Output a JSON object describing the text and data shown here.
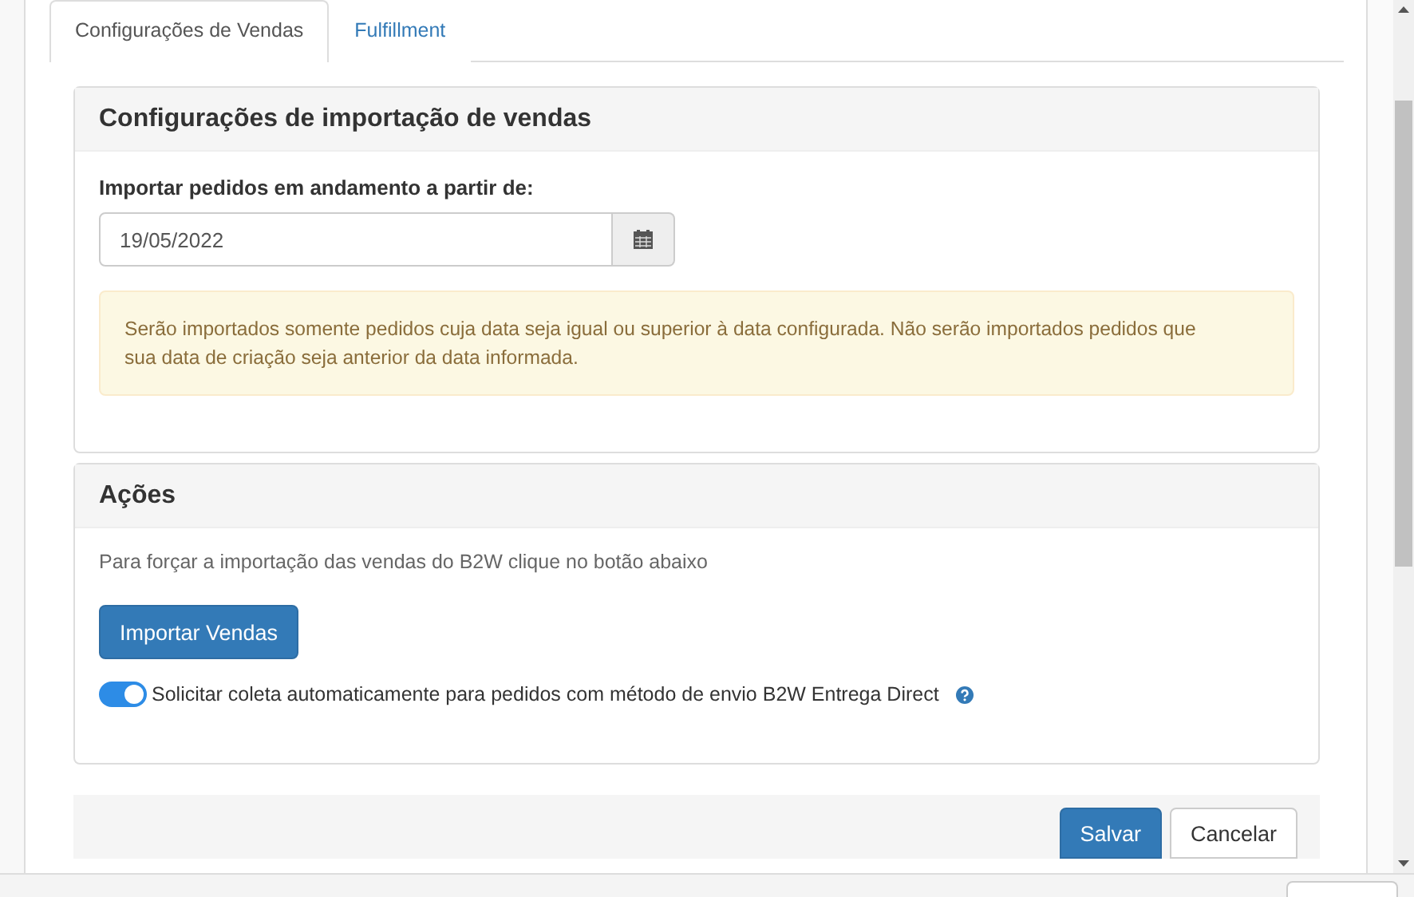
{
  "tabs": [
    {
      "label": "Configurações de Vendas",
      "selected": true
    },
    {
      "label": "Fulfillment",
      "selected": false
    }
  ],
  "import_panel": {
    "title": "Configurações de importação de vendas",
    "date_label": "Importar pedidos em andamento a partir de:",
    "date_value": "19/05/2022",
    "warning": "Serão importados somente pedidos cuja data seja igual ou superior à data configurada. Não serão importados pedidos que sua data de criação seja anterior da data informada."
  },
  "actions_panel": {
    "title": "Ações",
    "hint": "Para forçar a importação das vendas do B2W clique no botão abaixo",
    "import_button": "Importar Vendas",
    "auto_pickup": {
      "label": "Solicitar coleta automaticamente para pedidos com método de envio B2W Entrega Direct",
      "on": true
    }
  },
  "footer": {
    "buttons": [
      {
        "label": "Salvar",
        "kind": "primary"
      },
      {
        "label": "Cancelar",
        "kind": "default"
      }
    ]
  }
}
